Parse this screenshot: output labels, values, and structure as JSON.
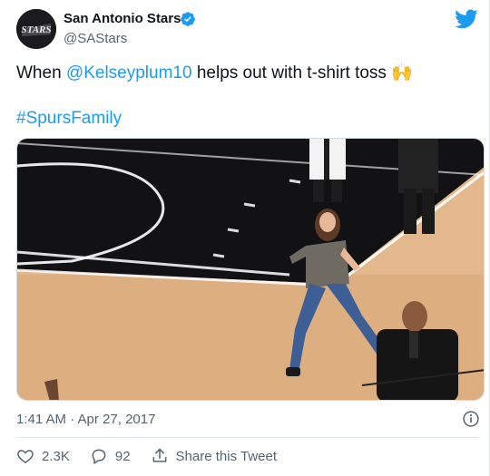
{
  "tweet": {
    "author_name": "San Antonio Stars",
    "handle": "@SAStars",
    "text_prefix": "When ",
    "mention": "@Kelseyplum10",
    "text_suffix": " helps out with t-shirt toss 🙌",
    "hashtag": "#SpursFamily",
    "timestamp": "1:41 AM · Apr 27, 2017",
    "likes": "2.3K",
    "replies": "92",
    "share_label": "Share this Tweet",
    "avatar_text": "STARS"
  },
  "icons": {
    "verified": "verified-badge-icon",
    "brand": "twitter-bird-icon",
    "info": "info-icon",
    "like": "heart-icon",
    "reply": "reply-bubble-icon",
    "share": "share-icon"
  },
  "colors": {
    "accent": "#1d9bf0",
    "text": "#0f1419",
    "muted": "#536471"
  }
}
